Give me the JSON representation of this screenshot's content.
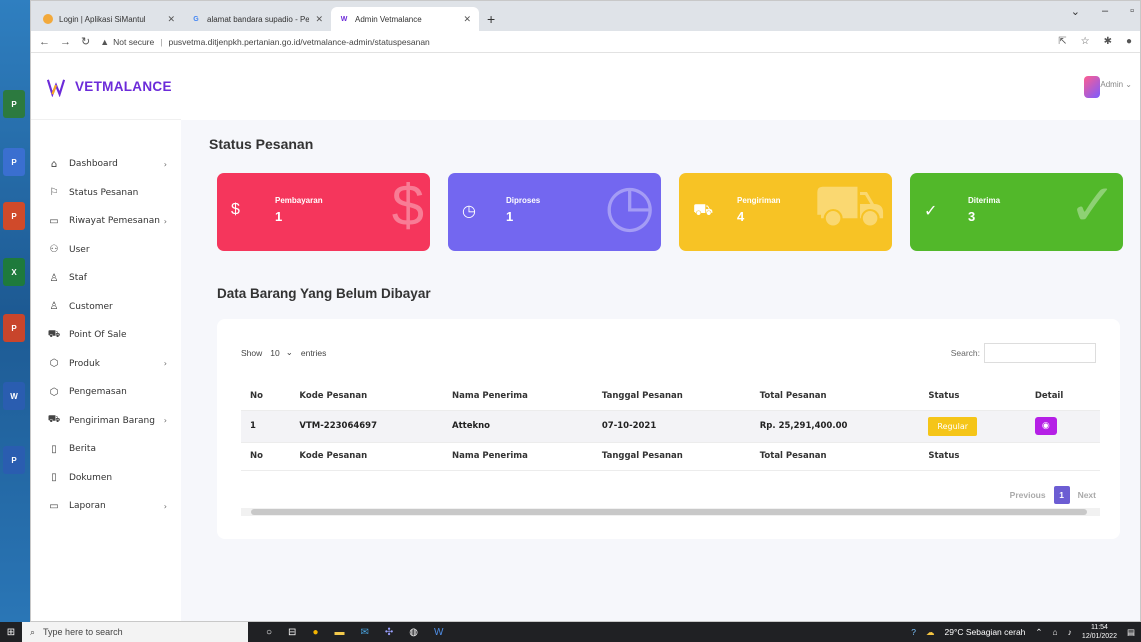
{
  "browser": {
    "tabs": [
      {
        "title": "Login | Aplikasi SiMantul",
        "active": false
      },
      {
        "title": "alamat bandara supadio - Peneli...",
        "active": false
      },
      {
        "title": "Admin Vetmalance",
        "active": true
      }
    ],
    "url_warning": "Not secure",
    "url": "pusvetma.ditjenpkh.pertanian.go.id/vetmalance-admin/statuspesanan"
  },
  "brand": {
    "name": "VETMALANCE",
    "color": "#6c2bd9"
  },
  "sidebar": {
    "items": [
      {
        "label": "Dashboard",
        "icon": "home-icon",
        "glyph": "⌂",
        "has_children": true
      },
      {
        "label": "Status Pesanan",
        "icon": "flag-icon",
        "glyph": "⚐",
        "has_children": false
      },
      {
        "label": "Riwayat Pemesanan",
        "icon": "folder-icon",
        "glyph": "▭",
        "has_children": true
      },
      {
        "label": "User",
        "icon": "users-icon",
        "glyph": "⚇",
        "has_children": false
      },
      {
        "label": "Staf",
        "icon": "user-icon",
        "glyph": "♙",
        "has_children": false
      },
      {
        "label": "Customer",
        "icon": "user-icon",
        "glyph": "♙",
        "has_children": false
      },
      {
        "label": "Point Of Sale",
        "icon": "cart-icon",
        "glyph": "⛟",
        "has_children": false
      },
      {
        "label": "Produk",
        "icon": "package-icon",
        "glyph": "⬡",
        "has_children": true
      },
      {
        "label": "Pengemasan",
        "icon": "package-icon",
        "glyph": "⬡",
        "has_children": false
      },
      {
        "label": "Pengiriman Barang",
        "icon": "truck-icon",
        "glyph": "⛟",
        "has_children": true
      },
      {
        "label": "Berita",
        "icon": "file-icon",
        "glyph": "▯",
        "has_children": false
      },
      {
        "label": "Dokumen",
        "icon": "file-icon",
        "glyph": "▯",
        "has_children": false
      },
      {
        "label": "Laporan",
        "icon": "folder-icon",
        "glyph": "▭",
        "has_children": true
      }
    ]
  },
  "topbar": {
    "user_label": "Admin ⌄"
  },
  "page": {
    "title": "Status Pesanan",
    "cards": [
      {
        "label": "Pembayaran",
        "value": "1",
        "color": "#f5365c",
        "icon": "dollar-icon",
        "glyph": "$"
      },
      {
        "label": "Diproses",
        "value": "1",
        "color": "#7367f0",
        "icon": "clock-icon",
        "glyph": "◷"
      },
      {
        "label": "Pengiriman",
        "value": "4",
        "color": "#f7c325",
        "icon": "truck-icon",
        "glyph": "⛟"
      },
      {
        "label": "Diterima",
        "value": "3",
        "color": "#52b82a",
        "icon": "check-circle-icon",
        "glyph": "✓"
      }
    ],
    "section_title": "Data Barang Yang Belum Dibayar",
    "datatable": {
      "show_label": "Show",
      "length_value": "10",
      "entries_label": "entries",
      "search_label": "Search:",
      "columns": [
        "No",
        "Kode Pesanan",
        "Nama Penerima",
        "Tanggal Pesanan",
        "Total Pesanan",
        "Status",
        "Detail"
      ],
      "footer_columns": [
        "No",
        "Kode Pesanan",
        "Nama Penerima",
        "Tanggal Pesanan",
        "Total Pesanan",
        "Status",
        ""
      ],
      "rows": [
        {
          "no": "1",
          "kode": "VTM-223064697",
          "nama": "Attekno",
          "tanggal": "07-10-2021",
          "total": "Rp. 25,291,400.00",
          "status": "Regular"
        }
      ],
      "pager": {
        "previous": "Previous",
        "current": "1",
        "next": "Next"
      }
    }
  },
  "taskbar": {
    "search_placeholder": "Type here to search",
    "weather": "29°C Sebagian cerah",
    "time": "11:54",
    "date": "12/01/2022"
  }
}
